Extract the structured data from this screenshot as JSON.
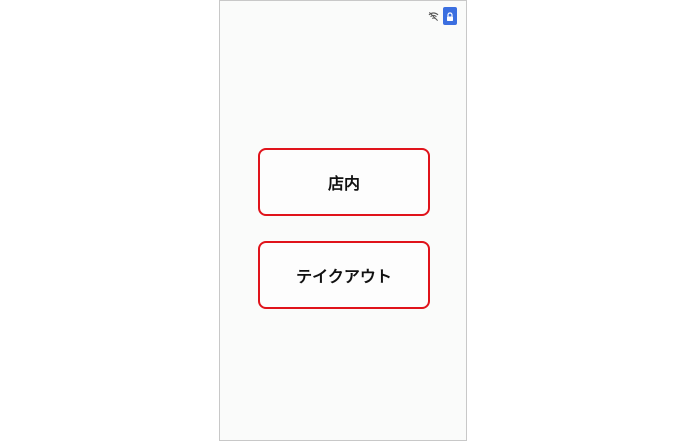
{
  "status_bar": {
    "wifi_icon": "wifi-off-icon",
    "lock_icon": "lock-icon",
    "lock_badge_color": "#3b6fe0"
  },
  "options": {
    "eat_in_label": "店内",
    "takeout_label": "テイクアウト",
    "border_color": "#e0131b"
  }
}
